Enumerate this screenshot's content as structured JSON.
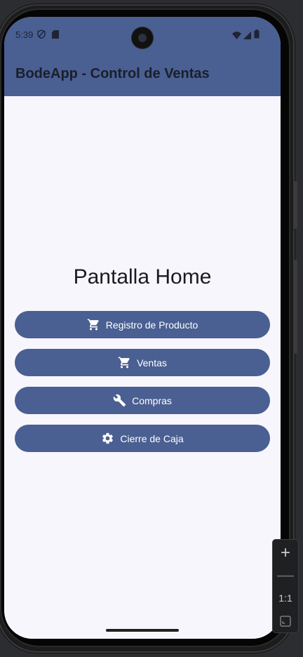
{
  "status_bar": {
    "time": "5:39",
    "left_icons": [
      "shield-icon",
      "sim-card-icon"
    ],
    "right_icons": [
      "wifi-icon",
      "signal-icon",
      "battery-icon"
    ]
  },
  "app_bar": {
    "title": "BodeApp - Control de Ventas",
    "color": "#4a5f92"
  },
  "home": {
    "title": "Pantalla Home",
    "buttons": [
      {
        "label": "Registro de Producto",
        "icon": "shopping-cart-icon"
      },
      {
        "label": "Ventas",
        "icon": "shopping-cart-icon"
      },
      {
        "label": "Compras",
        "icon": "wrench-icon"
      },
      {
        "label": "Cierre de Caja",
        "icon": "gear-icon"
      }
    ]
  },
  "emulator_zoom": {
    "plus": "+",
    "minus": "—",
    "ratio": "1:1",
    "fit_icon": "fit-screen-icon"
  },
  "colors": {
    "primary": "#4a5f92",
    "background": "#f7f6fd",
    "on_primary": "#ffffff"
  }
}
